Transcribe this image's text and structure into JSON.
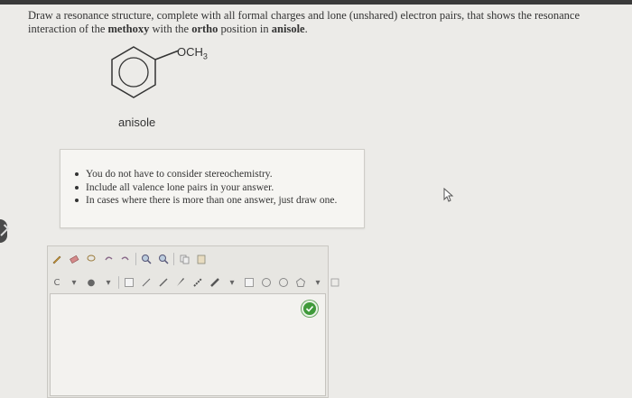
{
  "question": {
    "part1": "Draw a resonance structure, complete with all formal charges and lone (unshared) electron pairs, that shows the resonance interaction of the ",
    "bold1": "methoxy",
    "part2": " with the ",
    "bold2": "ortho",
    "part3": " position in ",
    "bold3": "anisole",
    "part4": "."
  },
  "molecule": {
    "name": "anisole",
    "substituent": "OCH",
    "substituent_sub": "3"
  },
  "hints": [
    "You do not have to consider stereochemistry.",
    "Include all valence lone pairs in your answer.",
    "In cases where there is more than one answer, just draw one."
  ],
  "editor": {
    "toolbar_row1_icons": [
      "pencil-icon",
      "eraser-icon",
      "lasso-icon",
      "undo-icon",
      "redo-icon",
      "zoom-in-icon",
      "zoom-out-icon",
      "copy-icon",
      "paste-icon"
    ],
    "toolbar_row2_icons": [
      "charge-icon",
      "atom-icon",
      "single-bond-icon",
      "double-bond-icon",
      "triple-bond-icon",
      "wedge-bond-icon",
      "dash-bond-icon",
      "ring-icon",
      "benzene-icon",
      "cyclohexane-icon",
      "template-icon"
    ]
  },
  "colors": {
    "check_button": "#3f9a3a",
    "background": "#ecebe8"
  }
}
